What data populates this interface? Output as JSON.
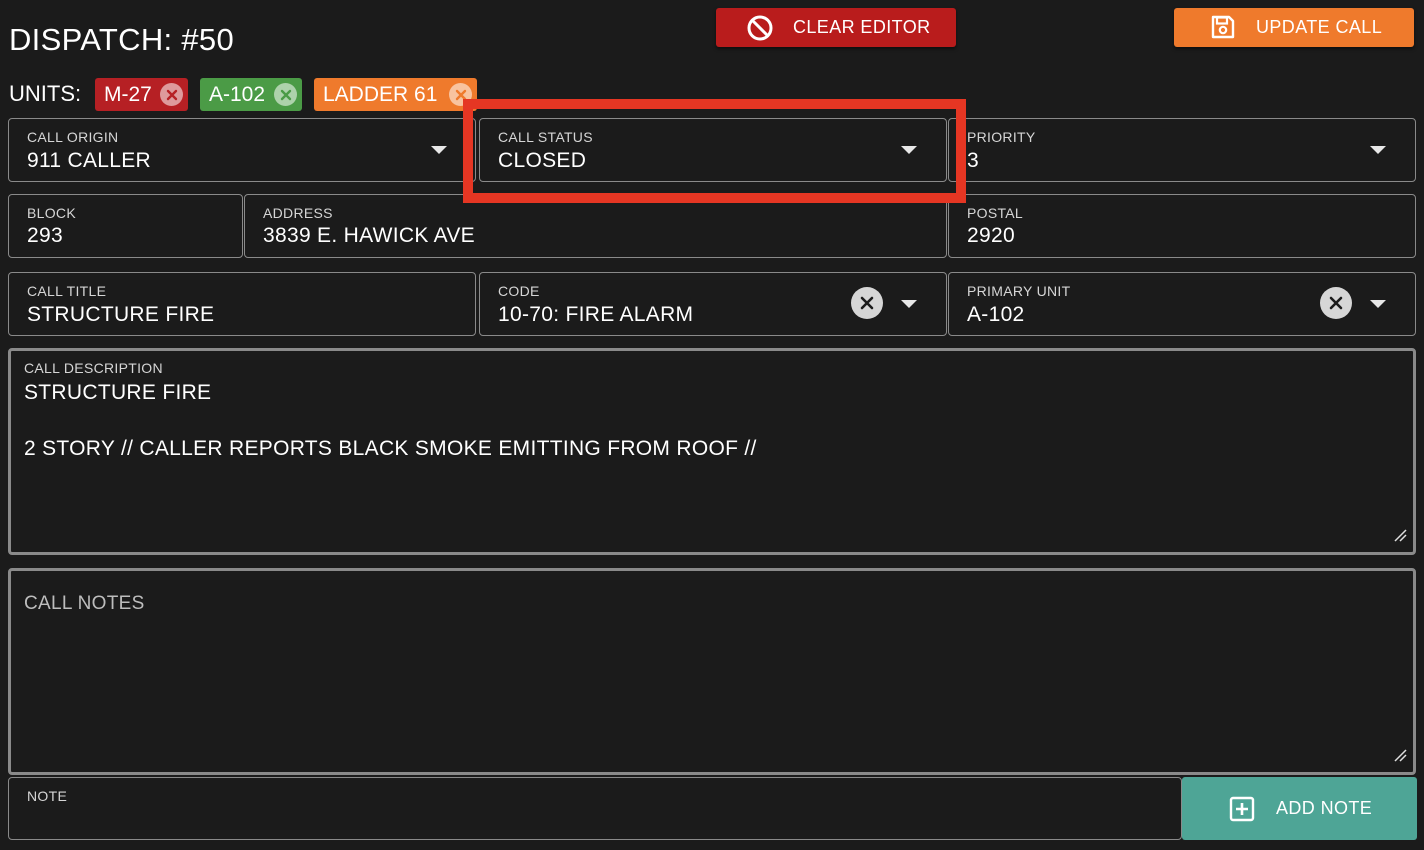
{
  "header": {
    "title": "DISPATCH: #50",
    "clear_label": "CLEAR EDITOR",
    "update_label": "UPDATE CALL"
  },
  "units": {
    "label": "UNITS:",
    "chips": [
      {
        "label": "M-27",
        "color": "#b62024"
      },
      {
        "label": "A-102",
        "color": "#4b9b46"
      },
      {
        "label": "LADDER 61",
        "color": "#ef7a2c"
      }
    ]
  },
  "fields": {
    "call_origin": {
      "label": "CALL ORIGIN",
      "value": "911 CALLER"
    },
    "call_status": {
      "label": "CALL STATUS",
      "value": "CLOSED"
    },
    "priority": {
      "label": "PRIORITY",
      "value": "3"
    },
    "block": {
      "label": "BLOCK",
      "value": "293"
    },
    "address": {
      "label": "ADDRESS",
      "value": "3839 E. HAWICK AVE"
    },
    "postal": {
      "label": "POSTAL",
      "value": "2920"
    },
    "call_title": {
      "label": "CALL TITLE",
      "value": "STRUCTURE FIRE"
    },
    "code": {
      "label": "CODE",
      "value": "10-70: FIRE ALARM"
    },
    "primary_unit": {
      "label": "PRIMARY UNIT",
      "value": "A-102"
    }
  },
  "description": {
    "label": "CALL DESCRIPTION",
    "line1": "STRUCTURE FIRE",
    "line2": "",
    "line3": "2 STORY // CALLER REPORTS BLACK SMOKE EMITTING FROM ROOF //"
  },
  "notes": {
    "placeholder": "CALL NOTES"
  },
  "note_input": {
    "label": "NOTE",
    "value": ""
  },
  "add_note_label": "ADD NOTE",
  "colors": {
    "background": "#1b1b1b",
    "danger": "#b91c1c",
    "warning": "#ef7a2c",
    "success": "#4ea596",
    "highlight": "#e53623"
  }
}
